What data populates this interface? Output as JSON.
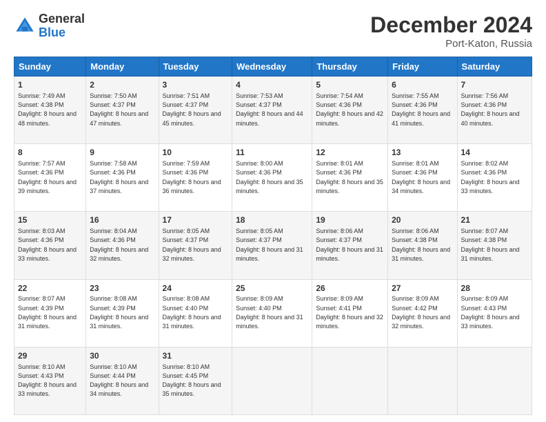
{
  "logo": {
    "general": "General",
    "blue": "Blue"
  },
  "title": "December 2024",
  "subtitle": "Port-Katon, Russia",
  "days_header": [
    "Sunday",
    "Monday",
    "Tuesday",
    "Wednesday",
    "Thursday",
    "Friday",
    "Saturday"
  ],
  "rows": [
    [
      {
        "num": "1",
        "rise": "7:49 AM",
        "set": "4:38 PM",
        "daylight": "8 hours and 48 minutes."
      },
      {
        "num": "2",
        "rise": "7:50 AM",
        "set": "4:37 PM",
        "daylight": "8 hours and 47 minutes."
      },
      {
        "num": "3",
        "rise": "7:51 AM",
        "set": "4:37 PM",
        "daylight": "8 hours and 45 minutes."
      },
      {
        "num": "4",
        "rise": "7:53 AM",
        "set": "4:37 PM",
        "daylight": "8 hours and 44 minutes."
      },
      {
        "num": "5",
        "rise": "7:54 AM",
        "set": "4:36 PM",
        "daylight": "8 hours and 42 minutes."
      },
      {
        "num": "6",
        "rise": "7:55 AM",
        "set": "4:36 PM",
        "daylight": "8 hours and 41 minutes."
      },
      {
        "num": "7",
        "rise": "7:56 AM",
        "set": "4:36 PM",
        "daylight": "8 hours and 40 minutes."
      }
    ],
    [
      {
        "num": "8",
        "rise": "7:57 AM",
        "set": "4:36 PM",
        "daylight": "8 hours and 39 minutes."
      },
      {
        "num": "9",
        "rise": "7:58 AM",
        "set": "4:36 PM",
        "daylight": "8 hours and 37 minutes."
      },
      {
        "num": "10",
        "rise": "7:59 AM",
        "set": "4:36 PM",
        "daylight": "8 hours and 36 minutes."
      },
      {
        "num": "11",
        "rise": "8:00 AM",
        "set": "4:36 PM",
        "daylight": "8 hours and 35 minutes."
      },
      {
        "num": "12",
        "rise": "8:01 AM",
        "set": "4:36 PM",
        "daylight": "8 hours and 35 minutes."
      },
      {
        "num": "13",
        "rise": "8:01 AM",
        "set": "4:36 PM",
        "daylight": "8 hours and 34 minutes."
      },
      {
        "num": "14",
        "rise": "8:02 AM",
        "set": "4:36 PM",
        "daylight": "8 hours and 33 minutes."
      }
    ],
    [
      {
        "num": "15",
        "rise": "8:03 AM",
        "set": "4:36 PM",
        "daylight": "8 hours and 33 minutes."
      },
      {
        "num": "16",
        "rise": "8:04 AM",
        "set": "4:36 PM",
        "daylight": "8 hours and 32 minutes."
      },
      {
        "num": "17",
        "rise": "8:05 AM",
        "set": "4:37 PM",
        "daylight": "8 hours and 32 minutes."
      },
      {
        "num": "18",
        "rise": "8:05 AM",
        "set": "4:37 PM",
        "daylight": "8 hours and 31 minutes."
      },
      {
        "num": "19",
        "rise": "8:06 AM",
        "set": "4:37 PM",
        "daylight": "8 hours and 31 minutes."
      },
      {
        "num": "20",
        "rise": "8:06 AM",
        "set": "4:38 PM",
        "daylight": "8 hours and 31 minutes."
      },
      {
        "num": "21",
        "rise": "8:07 AM",
        "set": "4:38 PM",
        "daylight": "8 hours and 31 minutes."
      }
    ],
    [
      {
        "num": "22",
        "rise": "8:07 AM",
        "set": "4:39 PM",
        "daylight": "8 hours and 31 minutes."
      },
      {
        "num": "23",
        "rise": "8:08 AM",
        "set": "4:39 PM",
        "daylight": "8 hours and 31 minutes."
      },
      {
        "num": "24",
        "rise": "8:08 AM",
        "set": "4:40 PM",
        "daylight": "8 hours and 31 minutes."
      },
      {
        "num": "25",
        "rise": "8:09 AM",
        "set": "4:40 PM",
        "daylight": "8 hours and 31 minutes."
      },
      {
        "num": "26",
        "rise": "8:09 AM",
        "set": "4:41 PM",
        "daylight": "8 hours and 32 minutes."
      },
      {
        "num": "27",
        "rise": "8:09 AM",
        "set": "4:42 PM",
        "daylight": "8 hours and 32 minutes."
      },
      {
        "num": "28",
        "rise": "8:09 AM",
        "set": "4:43 PM",
        "daylight": "8 hours and 33 minutes."
      }
    ],
    [
      {
        "num": "29",
        "rise": "8:10 AM",
        "set": "4:43 PM",
        "daylight": "8 hours and 33 minutes."
      },
      {
        "num": "30",
        "rise": "8:10 AM",
        "set": "4:44 PM",
        "daylight": "8 hours and 34 minutes."
      },
      {
        "num": "31",
        "rise": "8:10 AM",
        "set": "4:45 PM",
        "daylight": "8 hours and 35 minutes."
      },
      null,
      null,
      null,
      null
    ]
  ]
}
